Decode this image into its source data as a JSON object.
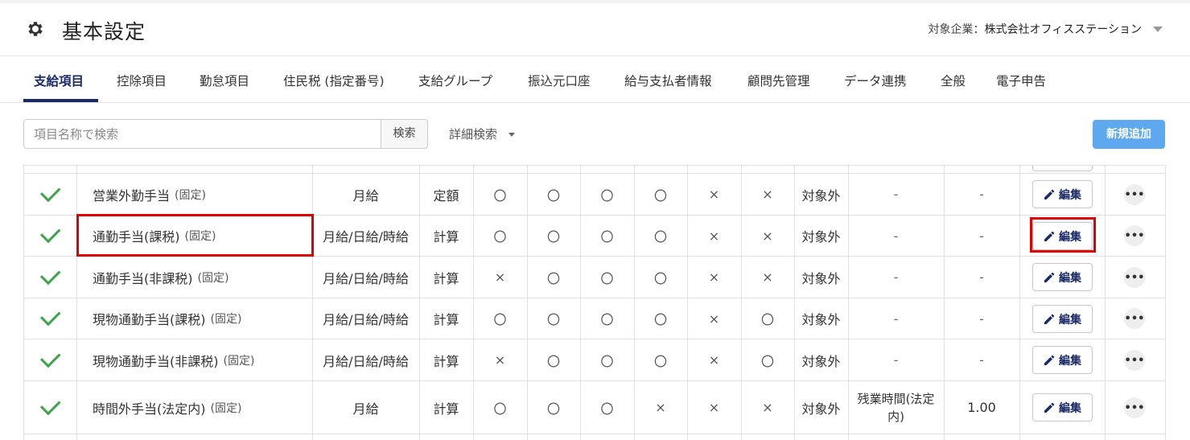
{
  "header": {
    "title": "基本設定",
    "company_label": "対象企業：",
    "company_name": "株式会社オフィスステーション"
  },
  "tabs": [
    {
      "label": "支給項目",
      "active": true
    },
    {
      "label": "控除項目"
    },
    {
      "label": "勤怠項目"
    },
    {
      "label": "住民税 (指定番号)"
    },
    {
      "label": "支給グループ"
    },
    {
      "label": "振込元口座"
    },
    {
      "label": "給与支払者情報"
    },
    {
      "label": "顧問先管理"
    },
    {
      "label": "データ連携"
    },
    {
      "label": "全般"
    },
    {
      "label": "電子申告"
    }
  ],
  "toolbar": {
    "search_placeholder": "項目名称で検索",
    "search_button": "検索",
    "advanced_search": "詳細検索",
    "new_button": "新規追加"
  },
  "table": {
    "fixed_tag": "(固定)",
    "edit_label": "編集",
    "more_label": "•••",
    "rows": [
      {
        "enabled": true,
        "name": "営業外勤手当",
        "pay": "月給",
        "calc": "定額",
        "c1": "〇",
        "c2": "〇",
        "c3": "〇",
        "c4": "〇",
        "c5": "×",
        "c6": "×",
        "c7": "対象外",
        "c8": "-",
        "c9": "-"
      },
      {
        "enabled": true,
        "name": "通勤手当(課税)",
        "pay": "月給/日給/時給",
        "calc": "計算",
        "c1": "〇",
        "c2": "〇",
        "c3": "〇",
        "c4": "〇",
        "c5": "×",
        "c6": "×",
        "c7": "対象外",
        "c8": "-",
        "c9": "-"
      },
      {
        "enabled": true,
        "name": "通勤手当(非課税)",
        "pay": "月給/日給/時給",
        "calc": "計算",
        "c1": "×",
        "c2": "〇",
        "c3": "〇",
        "c4": "〇",
        "c5": "×",
        "c6": "×",
        "c7": "対象外",
        "c8": "-",
        "c9": "-"
      },
      {
        "enabled": true,
        "name": "現物通勤手当(課税)",
        "pay": "月給/日給/時給",
        "calc": "計算",
        "c1": "〇",
        "c2": "〇",
        "c3": "〇",
        "c4": "〇",
        "c5": "×",
        "c6": "〇",
        "c7": "対象外",
        "c8": "-",
        "c9": "-"
      },
      {
        "enabled": true,
        "name": "現物通勤手当(非課税)",
        "pay": "月給/日給/時給",
        "calc": "計算",
        "c1": "×",
        "c2": "〇",
        "c3": "〇",
        "c4": "〇",
        "c5": "×",
        "c6": "〇",
        "c7": "対象外",
        "c8": "-",
        "c9": "-"
      },
      {
        "enabled": true,
        "name": "時間外手当(法定内)",
        "pay": "月給",
        "calc": "計算",
        "c1": "〇",
        "c2": "〇",
        "c3": "〇",
        "c4": "×",
        "c5": "×",
        "c6": "×",
        "c7": "対象外",
        "c8": "残業時間(法定内)",
        "c9": "1.00"
      }
    ]
  },
  "colors": {
    "accent": "#1a2a66",
    "primary_button": "#5ea8f0",
    "check": "#3fa34d",
    "highlight": "#e00000"
  }
}
